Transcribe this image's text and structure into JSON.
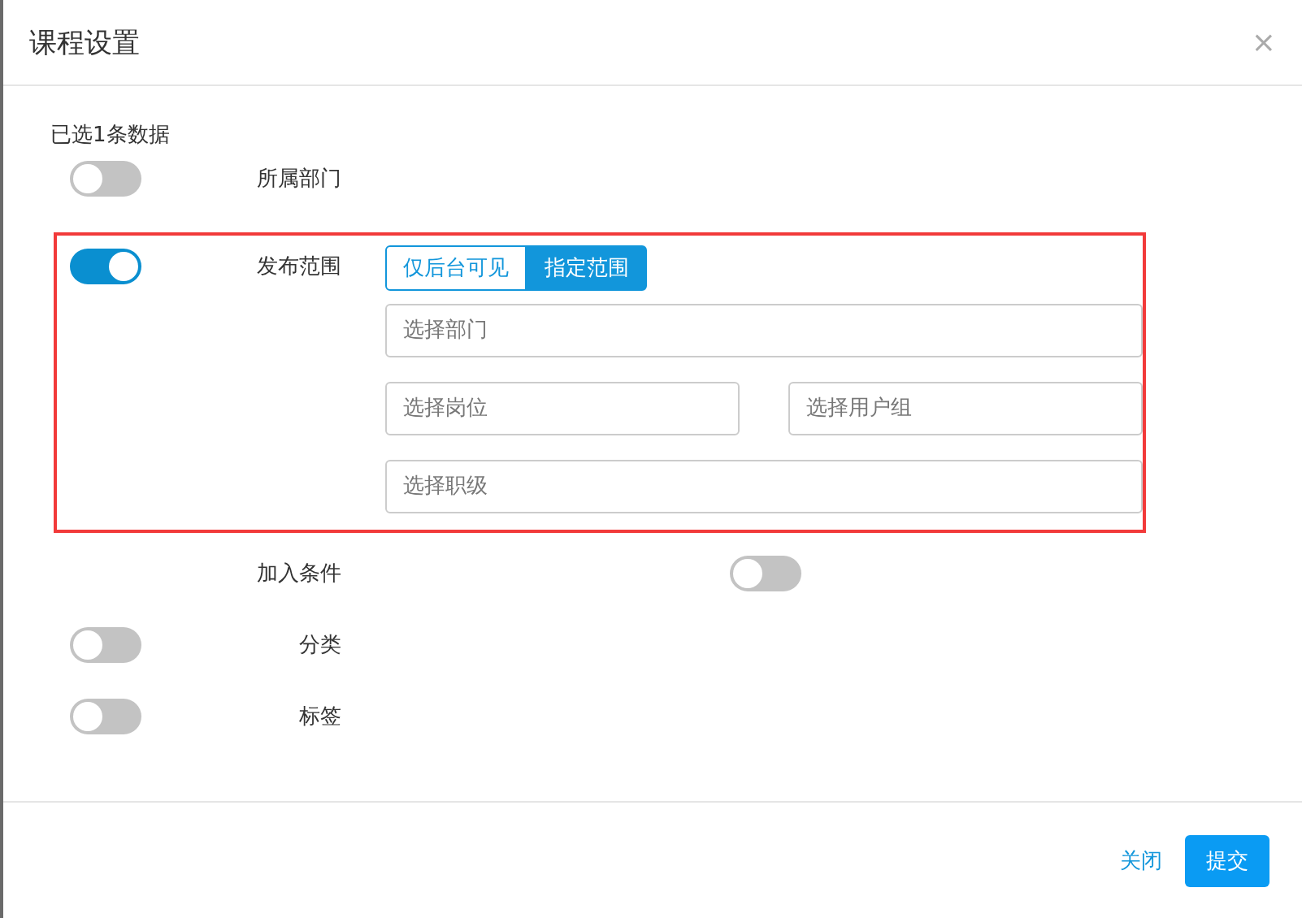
{
  "dialog": {
    "title": "课程设置",
    "close": "×"
  },
  "selection_note": "已选1条数据",
  "rows": [
    {
      "kind": "switch",
      "label": "所属部门",
      "on": false
    },
    {
      "kind": "scope",
      "label": "发布范围",
      "on": true,
      "highlighted": true,
      "options": [
        {
          "label": "仅后台可见",
          "selected": false
        },
        {
          "label": "指定范围",
          "selected": true
        }
      ],
      "fields": [
        [
          {
            "placeholder": "选择部门"
          }
        ],
        [
          {
            "placeholder": "选择岗位"
          },
          {
            "placeholder": "选择用户组"
          }
        ],
        [
          {
            "placeholder": "选择职级"
          }
        ]
      ]
    },
    {
      "kind": "inline",
      "label": "加入条件",
      "on": false
    },
    {
      "kind": "switch",
      "label": "分类",
      "on": false
    },
    {
      "kind": "switch",
      "label": "标签",
      "on": false
    }
  ],
  "footer": {
    "cancel": "关闭",
    "submit": "提交"
  }
}
